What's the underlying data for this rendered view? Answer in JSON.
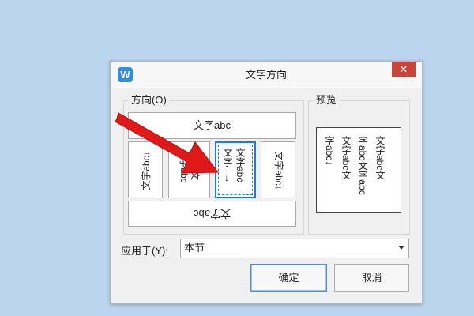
{
  "dialog": {
    "title": "文字方向",
    "app_icon": "W",
    "close_label": "✕"
  },
  "direction": {
    "group_label": "方向(O)",
    "horizontal_top": "文字abc",
    "vertical_cw": "文字abc",
    "vertical_stacked_line1": "文文",
    "vertical_stacked_line2": "字abc",
    "vertical_selected_col1": "文字abc",
    "vertical_selected_col2": "文字",
    "vertical_ccw": "文字abc",
    "horizontal_bottom": "文字abc"
  },
  "preview": {
    "group_label": "预览",
    "columns": [
      "文字abc文",
      "字abc文字abc",
      "文字abc文",
      "字abc"
    ]
  },
  "apply": {
    "label": "应用于(Y):",
    "value": "本节"
  },
  "buttons": {
    "ok": "确定",
    "cancel": "取消"
  },
  "colors": {
    "accent": "#1e7bd6",
    "close": "#c9453c",
    "annotation_arrow": "#e11818"
  }
}
